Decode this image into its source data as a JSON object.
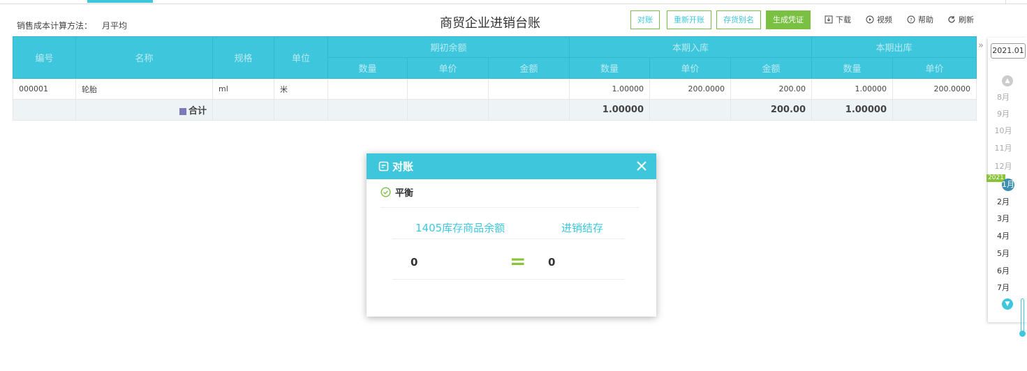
{
  "header": {
    "cost_method_label": "销售成本计算方法：",
    "cost_method_value": "月平均",
    "title": "商贸企业进销台账",
    "buttons": {
      "reconcile": "对账",
      "reopen": "重新开账",
      "alias": "存货别名",
      "voucher": "生成凭证"
    },
    "tools": {
      "download": "下载",
      "video": "视频",
      "help": "帮助",
      "refresh": "刷新"
    }
  },
  "table": {
    "headers": {
      "code": "编号",
      "name": "名称",
      "spec": "规格",
      "unit": "单位",
      "opening": "期初余额",
      "inbound": "本期入库",
      "outbound": "本期出库",
      "qty": "数量",
      "price": "单价",
      "amount": "金额"
    },
    "rows": [
      {
        "code": "000001",
        "name": "轮胎",
        "spec": "ml",
        "unit": "米",
        "open_qty": "",
        "open_price": "",
        "open_amount": "",
        "in_qty": "1.00000",
        "in_price": "200.0000",
        "in_amount": "200.00",
        "out_qty": "1.00000",
        "out_price": "200.0000"
      }
    ],
    "total": {
      "label": "合计",
      "in_qty": "1.00000",
      "in_amount": "200.00",
      "out_qty": "1.00000"
    }
  },
  "side": {
    "expand": "»",
    "year": "2021.01",
    "year_badge": "2021",
    "months_before": [
      "8月",
      "9月",
      "10月",
      "11月",
      "12月"
    ],
    "current": "1月",
    "months_after": [
      "2月",
      "3月",
      "4月",
      "5月",
      "6月",
      "7月"
    ]
  },
  "modal": {
    "title": "对账",
    "close": "✕",
    "status": "平衡",
    "left_label": "1405库存商品余额",
    "right_label": "进销结存",
    "left_value": "0",
    "eq": "=",
    "right_value": "0"
  },
  "colors": {
    "accent": "#3ec7dc",
    "green": "#7ac143"
  }
}
